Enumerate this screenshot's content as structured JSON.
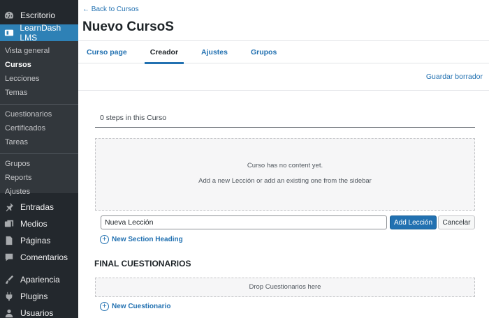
{
  "sidebar": {
    "dashboard": {
      "label": "Escritorio",
      "icon": "dashboard-icon"
    },
    "learndash": {
      "label": "LearnDash LMS",
      "icon": "learndash-icon"
    },
    "submenu": {
      "group1": [
        "Vista general",
        "Cursos",
        "Lecciones",
        "Temas"
      ],
      "group2": [
        "Cuestionarios",
        "Certificados",
        "Tareas"
      ],
      "group3": [
        "Grupos",
        "Reports",
        "Ajustes"
      ],
      "current": "Cursos"
    },
    "lower": [
      {
        "label": "Entradas",
        "icon": "pushpin-icon"
      },
      {
        "label": "Medios",
        "icon": "media-icon"
      },
      {
        "label": "Páginas",
        "icon": "pages-icon"
      },
      {
        "label": "Comentarios",
        "icon": "comments-icon"
      },
      {
        "label": "Apariencia",
        "icon": "appearance-icon"
      },
      {
        "label": "Plugins",
        "icon": "plugins-icon"
      },
      {
        "label": "Usuarios",
        "icon": "users-icon"
      }
    ]
  },
  "header": {
    "back_link": "← Back to Cursos",
    "title": "Nuevo CursoS"
  },
  "tabs": [
    "Curso page",
    "Creador",
    "Ajustes",
    "Grupos"
  ],
  "active_tab": "Creador",
  "save_draft": "Guardar borrador",
  "builder": {
    "steps_count": "0 steps in this Curso",
    "empty_line1": "Curso has no content yet.",
    "empty_line2": "Add a new Lección or add an existing one from the sidebar",
    "new_lesson_value": "Nueva Lección",
    "add_lesson_label": "Add Lección",
    "cancel_label": "Cancelar",
    "new_section_label": "New Section Heading",
    "quiz_heading": "FINAL CUESTIONARIOS",
    "drop_quiz": "Drop Cuestionarios here",
    "new_quiz_label": "New Cuestionario"
  },
  "colors": {
    "sidebar_bg": "#23282d",
    "submenu_bg": "#32373c",
    "accent": "#2271b1",
    "active_menu": "#2e81b6"
  }
}
